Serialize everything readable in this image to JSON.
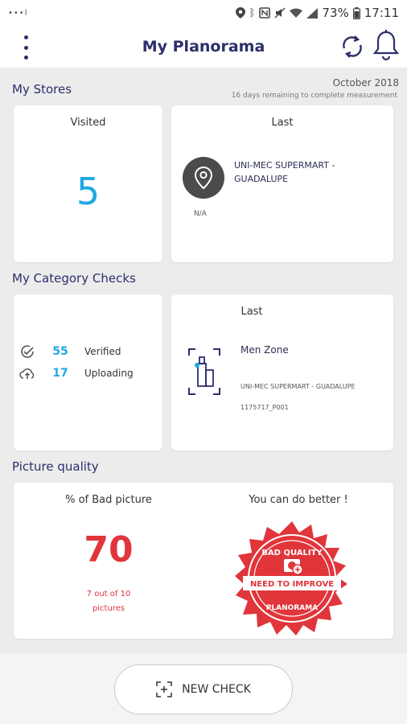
{
  "status_bar": {
    "left_text": "•••l",
    "battery": "73%",
    "time": "17:11",
    "icons": [
      "location-icon",
      "bluetooth-icon",
      "nfc-icon",
      "mute-icon",
      "wifi-icon",
      "signal-icon",
      "battery-icon"
    ]
  },
  "app_bar": {
    "title": "My Planorama",
    "icons": [
      "more-vert-icon",
      "sync-icon",
      "bell-icon"
    ]
  },
  "colors": {
    "accent": "#1ea9e1",
    "title": "#2c2f6b",
    "warning": "#e0353b",
    "background": "#ececec"
  },
  "stores": {
    "section_title": "My Stores",
    "period": "October 2018",
    "remaining": "16  days remaining to complete measurement",
    "visited_label": "Visited",
    "visited_count": "5",
    "last_label": "Last",
    "last_store": "UNI-MEC SUPERMART - GUADALUPE",
    "last_status": "N/A"
  },
  "categories": {
    "section_title": "My Category Checks",
    "verified_count": "55",
    "verified_label": "Verified",
    "uploading_count": "17",
    "uploading_label": "Uploading",
    "last_label": "Last",
    "last_zone": "Men Zone",
    "last_store": "UNI-MEC SUPERMART - GUADALUPE",
    "last_code": "1175717_P001"
  },
  "quality": {
    "section_title": "Picture quality",
    "bad_label": "% of Bad picture",
    "bad_percent": "70",
    "bad_line1": "7 out of 10",
    "bad_line2": "pictures",
    "advice": "You can do better !",
    "stamp_top": "BAD QUALITY",
    "stamp_middle": "NEED TO IMPROVE",
    "stamp_bottom": "PLANORAMA"
  },
  "footer": {
    "new_check_label": "NEW CHECK"
  }
}
